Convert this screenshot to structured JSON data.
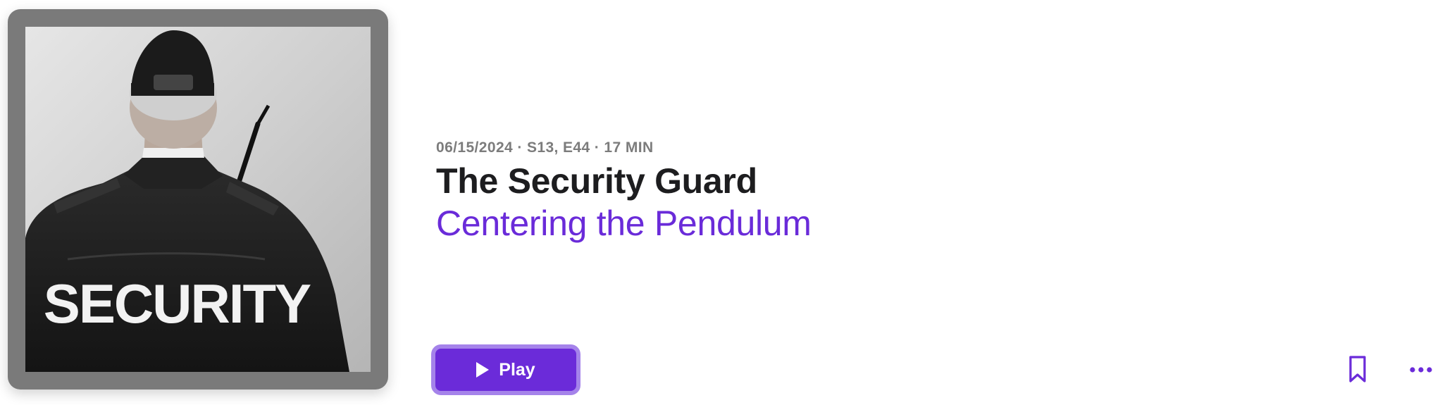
{
  "episode": {
    "meta": "06/15/2024 · S13, E44 · 17 MIN",
    "title": "The Security Guard",
    "show_title": "Centering the Pendulum",
    "artwork_text": "SECURITY"
  },
  "actions": {
    "play_label": "Play",
    "play_icon": "play-icon",
    "bookmark_icon": "bookmark-icon",
    "more_icon": "ellipsis-icon"
  },
  "colors": {
    "accent": "#6b2bd9",
    "accent_focus_ring": "#a583ea",
    "title": "#1d1d1f",
    "meta": "#7c7c7c",
    "artwork_frame": "#7a7a7a"
  }
}
